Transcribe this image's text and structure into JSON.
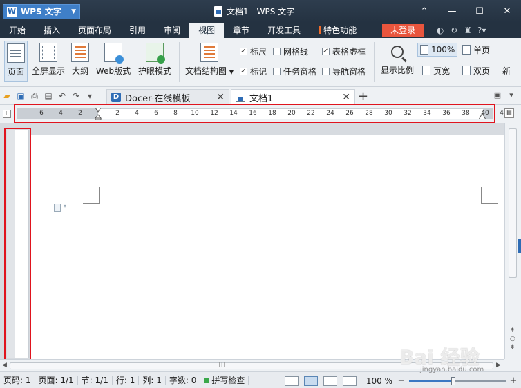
{
  "titlebar": {
    "app_button": "WPS 文字",
    "window_title": "文档1 - WPS 文字",
    "controls": [
      "⌃",
      "—",
      "☐",
      "✕"
    ]
  },
  "menu": {
    "items": [
      "开始",
      "插入",
      "页面布局",
      "引用",
      "审阅",
      "视图",
      "章节",
      "开发工具",
      "特色功能"
    ],
    "active": "视图",
    "login": "未登录"
  },
  "ribbon": {
    "view_buttons": [
      "页面",
      "全屏显示",
      "大纲",
      "Web版式",
      "护眼模式"
    ],
    "structure_button": "文档结构图",
    "checkboxes": [
      {
        "label": "标尺",
        "checked": true
      },
      {
        "label": "网格线",
        "checked": false
      },
      {
        "label": "表格虚框",
        "checked": true
      },
      {
        "label": "标记",
        "checked": true
      },
      {
        "label": "任务窗格",
        "checked": false
      },
      {
        "label": "导航窗格",
        "checked": false
      }
    ],
    "zoom_button": "显示比例",
    "zoom_100": "100%",
    "page_width": "页宽",
    "single_page": "单页",
    "double_page": "双页",
    "more": "新"
  },
  "tabs": {
    "docer": "Docer-在线模板",
    "doc1": "文档1"
  },
  "ruler": {
    "left_labels": [
      "6",
      "4",
      "2"
    ],
    "right_labels": [
      "2",
      "4",
      "6",
      "8",
      "10",
      "12",
      "14",
      "16",
      "18",
      "20",
      "22",
      "24",
      "26",
      "28",
      "30",
      "32",
      "34",
      "36",
      "38",
      "40"
    ],
    "overflow_label": "4"
  },
  "status": {
    "page_num": "页码: 1",
    "pages": "页面: 1/1",
    "section": "节: 1/1",
    "row": "行: 1",
    "col": "列: 1",
    "words": "字数: 0",
    "spell": "拼写检查",
    "zoom": "100 %",
    "zoom_percent": 100
  },
  "watermark": {
    "brand": "Bai 经验",
    "sub": "jingyan.baidu.com"
  }
}
